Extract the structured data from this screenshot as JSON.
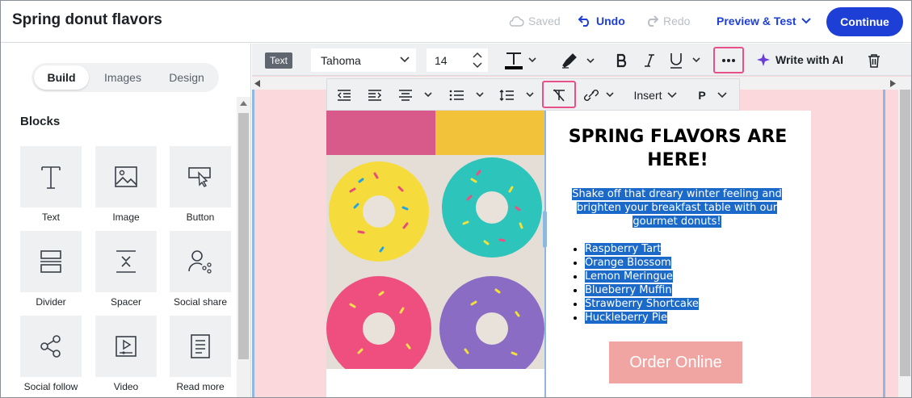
{
  "header": {
    "title": "Spring donut flavors",
    "saved": "Saved",
    "undo": "Undo",
    "redo": "Redo",
    "preview": "Preview & Test",
    "continue": "Continue"
  },
  "sidebar": {
    "tabs": [
      {
        "label": "Build",
        "active": true
      },
      {
        "label": "Images",
        "active": false
      },
      {
        "label": "Design",
        "active": false
      }
    ],
    "blocks_heading": "Blocks",
    "blocks": [
      {
        "label": "Text",
        "icon": "text-icon"
      },
      {
        "label": "Image",
        "icon": "image-icon"
      },
      {
        "label": "Button",
        "icon": "button-icon"
      },
      {
        "label": "Divider",
        "icon": "divider-icon"
      },
      {
        "label": "Spacer",
        "icon": "spacer-icon"
      },
      {
        "label": "Social share",
        "icon": "social-share-icon"
      },
      {
        "label": "Social follow",
        "icon": "social-follow-icon"
      },
      {
        "label": "Video",
        "icon": "video-icon"
      },
      {
        "label": "Read more",
        "icon": "read-more-icon"
      }
    ]
  },
  "toolbar": {
    "block_type": "Text",
    "font": "Tahoma",
    "font_size": "14",
    "write_ai": "Write with AI",
    "insert": "Insert",
    "paragraph": "P"
  },
  "email": {
    "headline": "SPRING FLAVORS ARE HERE!",
    "paragraph": "Shake off that dreary winter feeling and brighten your breakfast table with our gourmet donuts!",
    "flavors": [
      "Raspberry Tart",
      "Orange Blossom",
      "Lemon Meringue",
      "Blueberry Muffin",
      "Strawberry Shortcake",
      "Huckleberry Pie"
    ],
    "button": "Order Online"
  },
  "colors": {
    "primary": "#1d3fd6",
    "highlight_box": "#e8508a",
    "canvas_bg": "#fbd8dc",
    "selection": "#1b6ac9",
    "order_button": "#f0a5a3"
  }
}
